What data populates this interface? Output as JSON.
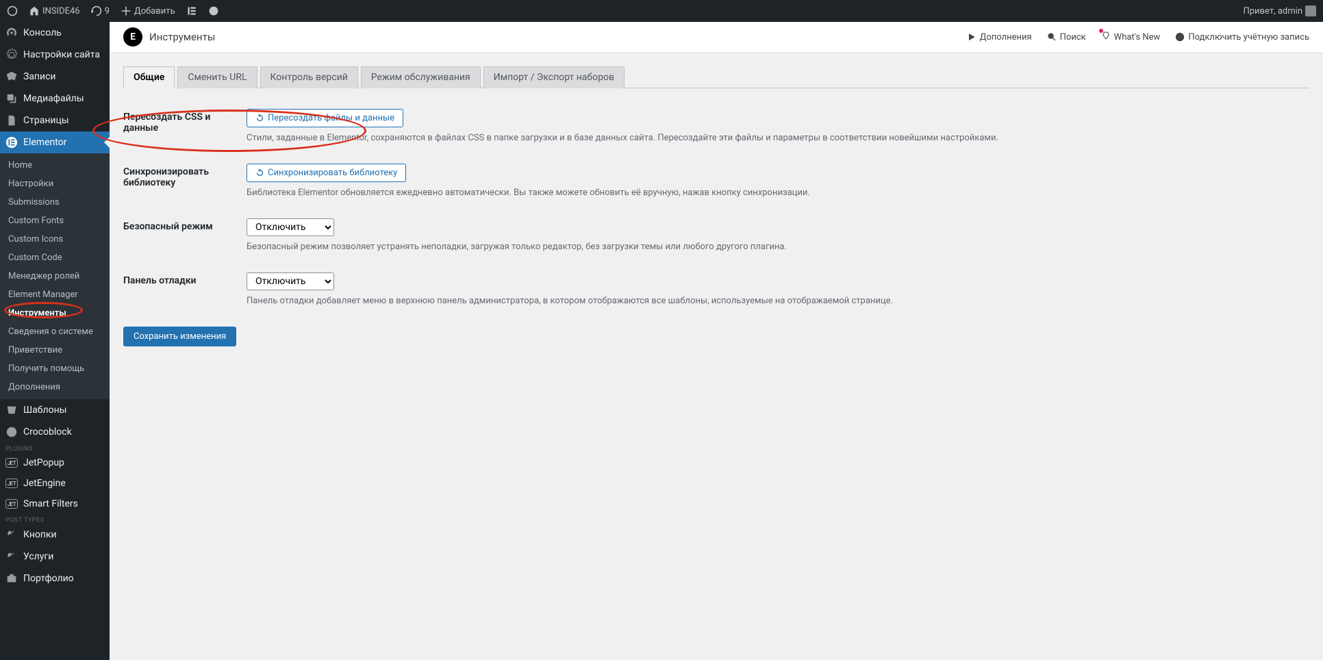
{
  "topbar": {
    "site_name": "INSIDE46",
    "updates_count": "9",
    "add_label": "Добавить",
    "greeting": "Привет, admin"
  },
  "sidebar": {
    "main": [
      {
        "icon": "speedometer",
        "label": "Консоль"
      },
      {
        "icon": "gear",
        "label": "Настройки сайта"
      },
      {
        "icon": "pin",
        "label": "Записи"
      },
      {
        "icon": "media",
        "label": "Медиафайлы"
      },
      {
        "icon": "pages",
        "label": "Страницы"
      }
    ],
    "elementor_label": "Elementor",
    "submenu": [
      "Home",
      "Настройки",
      "Submissions",
      "Custom Fonts",
      "Custom Icons",
      "Custom Code",
      "Менеджер ролей",
      "Element Manager",
      "Инструменты",
      "Сведения о системе",
      "Приветствие",
      "Получить помощь",
      "Дополнения"
    ],
    "after": [
      {
        "icon": "templates",
        "label": "Шаблоны"
      },
      {
        "icon": "croco",
        "label": "Crocoblock"
      }
    ],
    "plugins_sep": "PLUGINS",
    "plugins": [
      "JetPopup",
      "JetEngine",
      "Smart Filters"
    ],
    "posttypes_sep": "POST TYPES",
    "posttypes": [
      {
        "icon": "link",
        "label": "Кнопки"
      },
      {
        "icon": "link",
        "label": "Услуги"
      },
      {
        "icon": "portfolio",
        "label": "Портфолио"
      }
    ]
  },
  "header": {
    "title": "Инструменты",
    "right": {
      "addons": "Дополнения",
      "search": "Поиск",
      "whatsnew": "What's New",
      "connect": "Подключить учётную запись"
    }
  },
  "tabs": [
    "Общие",
    "Сменить URL",
    "Контроль версий",
    "Режим обслуживания",
    "Импорт / Экспорт наборов"
  ],
  "form": {
    "row1": {
      "label": "Пересоздать CSS и данные",
      "btn": "Пересоздать файлы и данные",
      "desc": "Стили, заданные в Elementor, сохраняются в файлах CSS в папке загрузки и в базе данных сайта. Пересоздайте эти файлы и параметры в соответствии новейшими настройками."
    },
    "row2": {
      "label": "Синхронизировать библиотеку",
      "btn": "Синхронизировать библиотеку",
      "desc": "Библиотека Elementor обновляется ежедневно автоматически. Вы также можете обновить её вручную, нажав кнопку синхронизации."
    },
    "row3": {
      "label": "Безопасный режим",
      "select": "Отключить",
      "desc": "Безопасный режим позволяет устранять неполадки, загружая только редактор, без загрузки темы или любого другого плагина."
    },
    "row4": {
      "label": "Панель отладки",
      "select": "Отключить",
      "desc": "Панель отладки добавляет меню в верхнюю панель администратора, в котором отображаются все шаблоны, используемые на отображаемой странице."
    },
    "save": "Сохранить изменения"
  }
}
